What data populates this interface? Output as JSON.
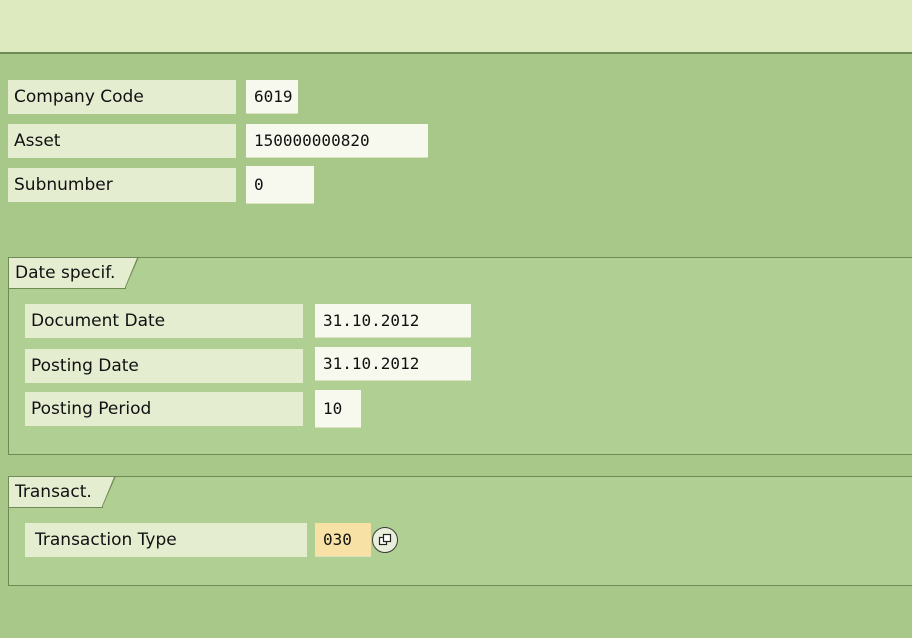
{
  "header": {
    "company_code_label": "Company Code",
    "company_code_value": "6019",
    "asset_label": "Asset",
    "asset_value": "150000000820",
    "subnumber_label": "Subnumber",
    "subnumber_value": "0"
  },
  "date_group": {
    "title": "Date specif.",
    "document_date_label": "Document Date",
    "document_date_value": "31.10.2012",
    "posting_date_label": "Posting Date",
    "posting_date_value": "31.10.2012",
    "posting_period_label": "Posting Period",
    "posting_period_value": "10"
  },
  "transaction_group": {
    "title": "Transact.",
    "transaction_type_label": "Transaction Type",
    "transaction_type_value": "030",
    "value_help_icon": "value-help-icon"
  },
  "colors": {
    "background": "#a8c88a",
    "toolbar": "#dde9bf",
    "label_bg": "#e5edd1",
    "field_bg": "#f7f9ee",
    "required_field_bg": "#f8e1a5"
  }
}
